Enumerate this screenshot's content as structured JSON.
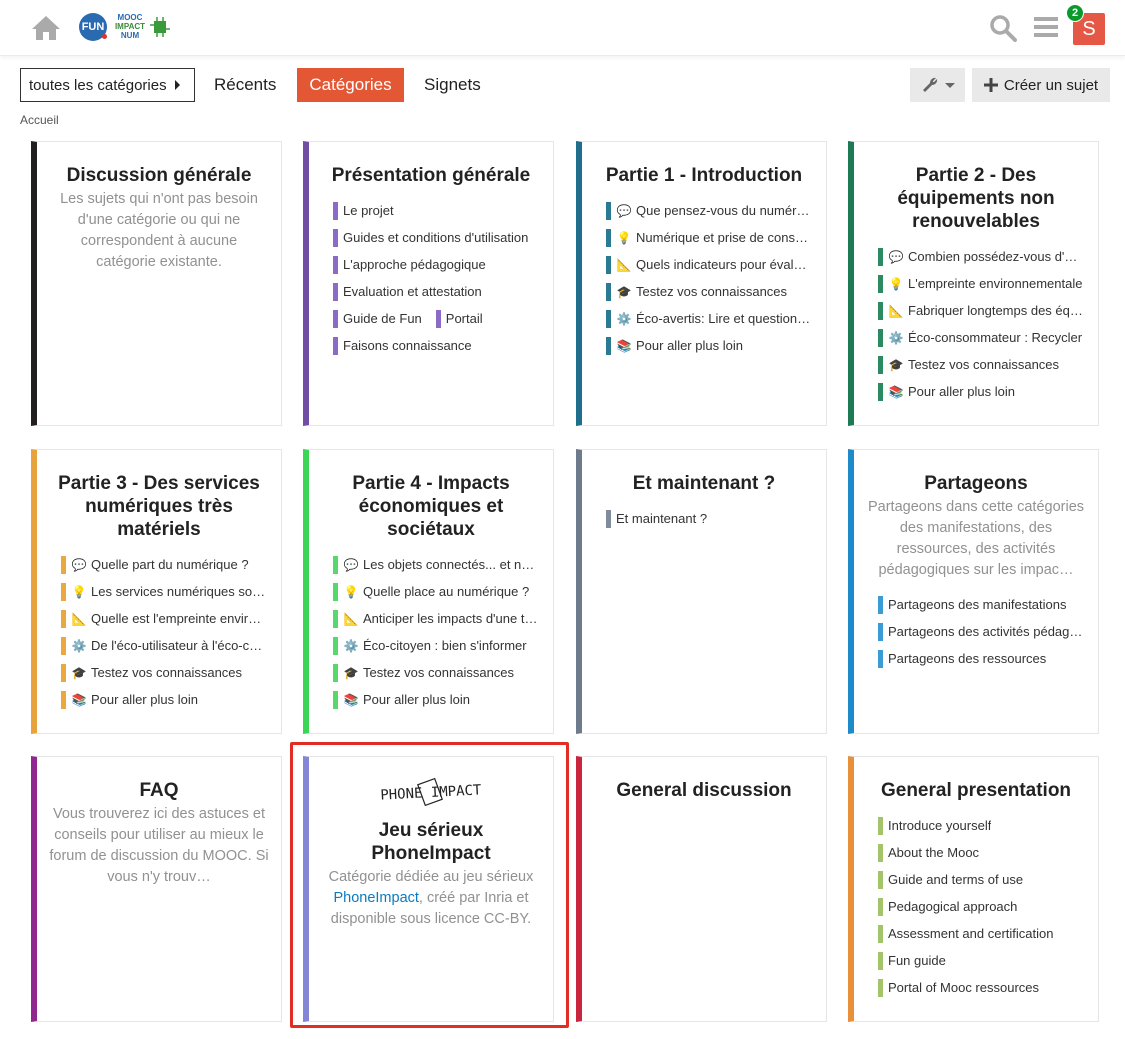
{
  "header": {
    "logo_fun": "FUN",
    "logo_mooc_lines": [
      "MOOC",
      "IMPACT",
      "NUM"
    ],
    "avatar_letter": "S",
    "notification_count": "2",
    "accent": "#e45735"
  },
  "nav": {
    "dropdown_label": "toutes les catégories",
    "links": [
      "Récents",
      "Catégories",
      "Signets"
    ],
    "active": "Catégories",
    "create_label": "Créer un sujet"
  },
  "breadcrumb": "Accueil",
  "cards": [
    {
      "title": "Discussion générale",
      "color": "#231f20",
      "desc": "Les sujets qui n'ont pas besoin d'une catégorie ou qui ne correspondent à aucune catégorie existante.",
      "items": []
    },
    {
      "title": "Présentation générale",
      "color": "#6f4ea3",
      "desc": "",
      "items": [
        {
          "emoji": "",
          "label": "Le projet",
          "color": "#8c6bc8"
        },
        {
          "emoji": "",
          "label": "Guides et conditions d'utilisation",
          "color": "#8c6bc8"
        },
        {
          "emoji": "",
          "label": "L'approche pédagogique",
          "color": "#8c6bc8"
        },
        {
          "emoji": "",
          "label": "Evaluation et attestation",
          "color": "#8c6bc8"
        },
        {
          "emoji": "",
          "label": "Guide de Fun",
          "color": "#8c6bc8",
          "pair": "Portail"
        },
        {
          "emoji": "",
          "label": "Faisons connaissance",
          "color": "#8c6bc8"
        }
      ]
    },
    {
      "title": "Partie 1 - Introduction",
      "color": "#1e6e8c",
      "desc": "",
      "items": [
        {
          "emoji": "💬",
          "label": "Que pensez-vous du numérique ?",
          "color": "#2a7a94"
        },
        {
          "emoji": "💡",
          "label": "Numérique et prise de conscience",
          "color": "#2a7a94"
        },
        {
          "emoji": "📐",
          "label": "Quels indicateurs pour évaluer ?",
          "color": "#2a7a94"
        },
        {
          "emoji": "🎓",
          "label": "Testez vos connaissances",
          "color": "#2a7a94"
        },
        {
          "emoji": "⚙️",
          "label": "Éco-avertis: Lire et questionner",
          "color": "#2a7a94"
        },
        {
          "emoji": "📚",
          "label": "Pour aller plus loin",
          "color": "#2a7a94"
        }
      ]
    },
    {
      "title": "Partie 2 - Des équipements non renouvelables",
      "color": "#1e7a55",
      "desc": "",
      "items": [
        {
          "emoji": "💬",
          "label": "Combien possédez-vous d'équipements ?",
          "color": "#2b8a62"
        },
        {
          "emoji": "💡",
          "label": "L'empreinte environnementale",
          "color": "#2b8a62"
        },
        {
          "emoji": "📐",
          "label": "Fabriquer longtemps des équipements",
          "color": "#2b8a62"
        },
        {
          "emoji": "⚙️",
          "label": "Éco-consommateur : Recycler",
          "color": "#2b8a62"
        },
        {
          "emoji": "🎓",
          "label": "Testez vos connaissances",
          "color": "#2b8a62"
        },
        {
          "emoji": "📚",
          "label": "Pour aller plus loin",
          "color": "#2b8a62"
        }
      ]
    },
    {
      "title": "Partie 3 - Des services numériques très matériels",
      "color": "#e8a33c",
      "desc": "",
      "items": [
        {
          "emoji": "💬",
          "label": "Quelle part du numérique ?",
          "color": "#eaa83f"
        },
        {
          "emoji": "💡",
          "label": "Les services numériques sont matériels",
          "color": "#eaa83f"
        },
        {
          "emoji": "📐",
          "label": "Quelle est l'empreinte environnementale ?",
          "color": "#eaa83f"
        },
        {
          "emoji": "⚙️",
          "label": "De l'éco-utilisateur à l'éco-concepteur",
          "color": "#eaa83f"
        },
        {
          "emoji": "🎓",
          "label": "Testez vos connaissances",
          "color": "#eaa83f"
        },
        {
          "emoji": "📚",
          "label": "Pour aller plus loin",
          "color": "#eaa83f"
        }
      ]
    },
    {
      "title": "Partie 4 - Impacts économiques et sociétaux",
      "color": "#3cd554",
      "desc": "",
      "items": [
        {
          "emoji": "💬",
          "label": "Les objets connectés... et nous ?",
          "color": "#56d96a"
        },
        {
          "emoji": "💡",
          "label": "Quelle place au numérique ?",
          "color": "#56d96a"
        },
        {
          "emoji": "📐",
          "label": "Anticiper les impacts d'une technologie",
          "color": "#56d96a"
        },
        {
          "emoji": "⚙️",
          "label": "Éco-citoyen : bien s'informer",
          "color": "#56d96a"
        },
        {
          "emoji": "🎓",
          "label": "Testez vos connaissances",
          "color": "#56d96a"
        },
        {
          "emoji": "📚",
          "label": "Pour aller plus loin",
          "color": "#56d96a"
        }
      ]
    },
    {
      "title": "Et maintenant ?",
      "color": "#6d7b8d",
      "desc": "",
      "items": [
        {
          "emoji": "",
          "label": "Et maintenant ?",
          "color": "#808c9c"
        }
      ]
    },
    {
      "title": "Partageons",
      "color": "#1f8ac9",
      "desc": "Partageons dans cette catégories des manifestations, des ressources, des activités pédagogiques sur les impac…",
      "items": [
        {
          "emoji": "",
          "label": "Partageons des manifestations",
          "color": "#3a9bd5"
        },
        {
          "emoji": "",
          "label": "Partageons des activités pédagogiques",
          "color": "#3a9bd5"
        },
        {
          "emoji": "",
          "label": "Partageons des ressources",
          "color": "#3a9bd5"
        }
      ]
    },
    {
      "title": "FAQ",
      "color": "#92278f",
      "desc": "Vous trouverez ici des astuces et conseils pour utiliser au mieux le forum de discussion du MOOC. Si vous n'y trouv…",
      "items": []
    },
    {
      "title": "Jeu sérieux PhoneImpact",
      "color": "#8585d8",
      "desc_before": "Catégorie dédiée au jeu sérieux ",
      "desc_link": "PhoneImpact",
      "desc_after": ", créé par Inria et disponible sous licence CC-BY.",
      "logo_text": "PHONE IMPACT",
      "items": []
    },
    {
      "title": "General discussion",
      "color": "#c9253c",
      "desc": "",
      "items": []
    },
    {
      "title": "General presentation",
      "color": "#e8913a",
      "desc": "",
      "items": [
        {
          "emoji": "",
          "label": "Introduce yourself",
          "color": "#a3c46b"
        },
        {
          "emoji": "",
          "label": "About the Mooc",
          "color": "#a3c46b"
        },
        {
          "emoji": "",
          "label": "Guide and terms of use",
          "color": "#a3c46b"
        },
        {
          "emoji": "",
          "label": "Pedagogical approach",
          "color": "#a3c46b"
        },
        {
          "emoji": "",
          "label": "Assessment and certification",
          "color": "#a3c46b"
        },
        {
          "emoji": "",
          "label": "Fun guide",
          "color": "#a3c46b"
        },
        {
          "emoji": "",
          "label": "Portal of Mooc ressources",
          "color": "#a3c46b"
        }
      ]
    }
  ]
}
